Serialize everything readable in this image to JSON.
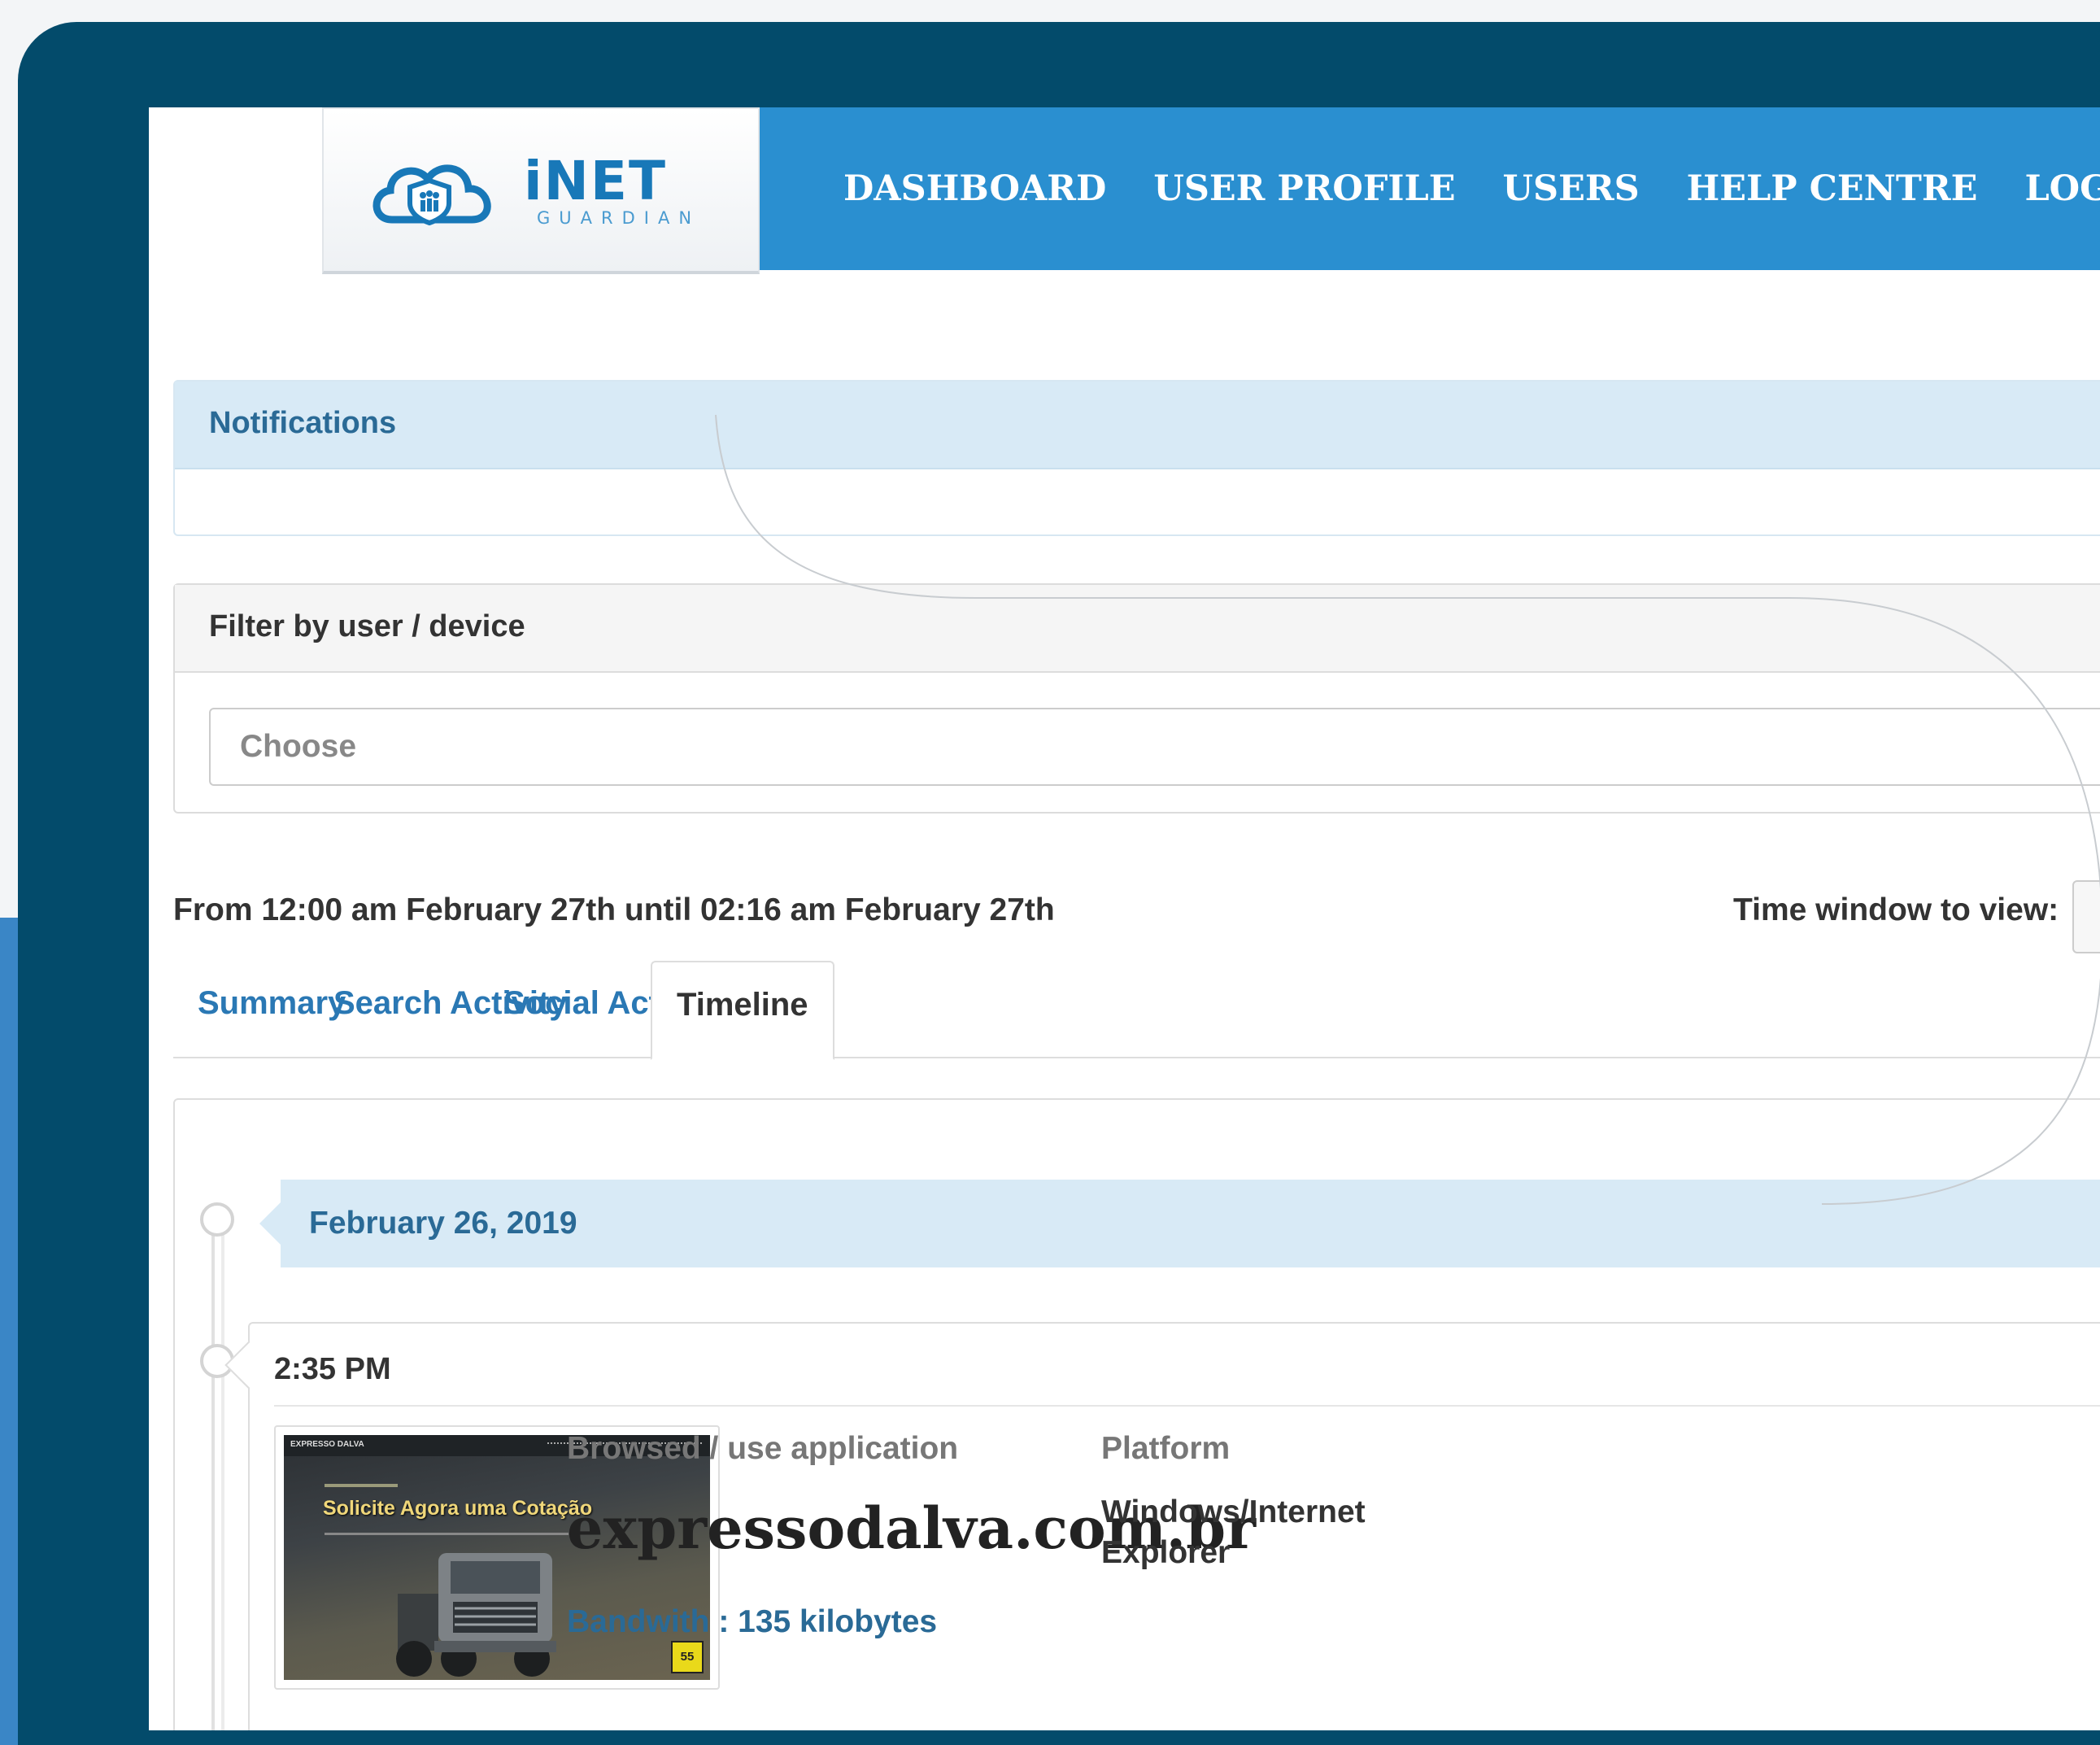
{
  "brand": {
    "name": "iNET",
    "tagline": "GUARDIAN"
  },
  "nav": [
    {
      "label": "DASHBOARD"
    },
    {
      "label": "USER PROFILE"
    },
    {
      "label": "USERS"
    },
    {
      "label": "HELP CENTRE"
    },
    {
      "label": "LOGOUT"
    }
  ],
  "notifications": {
    "title": "Notifications"
  },
  "filter": {
    "title": "Filter by user / device",
    "placeholder": "Choose"
  },
  "range": {
    "text": "From 12:00 am February 27th until 02:16 am February 27th",
    "time_window_label": "Time window to view:"
  },
  "tabs": [
    {
      "label": "Summary"
    },
    {
      "label": "Search Activity"
    },
    {
      "label": "Social Activity"
    },
    {
      "label": "Timeline",
      "active": true
    }
  ],
  "timeline": {
    "date": "February 26, 2019",
    "entry": {
      "time": "2:35 PM",
      "browsed_label": "Browsed / use application",
      "site": "expressodalva.com.br",
      "bandwidth": "Bandwith : 135 kilobytes",
      "platform_label": "Platform",
      "platform_value": "Windows/Internet Explorer",
      "thumbnail": {
        "brand": "EXPRESSO DALVA",
        "headline": "Solicite Agora uma Cotação"
      }
    }
  },
  "colors": {
    "frame": "#034b6b",
    "nav": "#2a8fd0",
    "link": "#2a78b4",
    "panel_head": "#d8eaf6"
  }
}
